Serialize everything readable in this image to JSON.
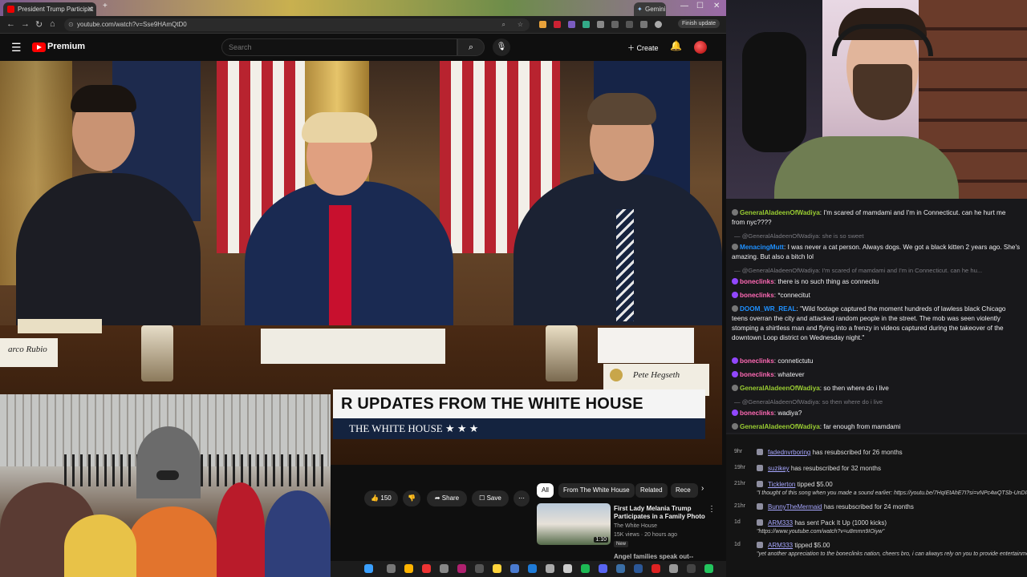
{
  "browser": {
    "tab_title": "President Trump Participat",
    "tab2_title": "Gemini",
    "url": "youtube.com/watch?v=Sse9HAmQtD0",
    "finish_update": "Finish update"
  },
  "youtube": {
    "brand": "Premium",
    "search_placeholder": "Search",
    "create_label": "Create"
  },
  "video": {
    "nameplate_left": "arco Rubio",
    "nameplate_right": "Pete Hegseth",
    "lower_third_title": "R UPDATES FROM THE WHITE HOUSE",
    "lower_third_sub": "THE WHITE HOUSE  ★ ★ ★"
  },
  "actions": {
    "likes": "150",
    "share": "Share",
    "save": "Save"
  },
  "chips": [
    "All",
    "From The White House",
    "Related",
    "Rece"
  ],
  "related": {
    "title": "First Lady Melania Trump Participates in a Family Photo",
    "channel": "The White House",
    "meta": "15K views · 20 hours ago",
    "badge": "New",
    "duration": "1:10",
    "next_title": "Angel families speak out--"
  },
  "chat": [
    {
      "type": "msg",
      "user": "GeneralAladeenOfWadiya",
      "color": "#9acd32",
      "text": " I'm scared of mamdami and I'm in Connecticut. can he hurt me from nyc????"
    },
    {
      "type": "reply",
      "text": "— @GeneralAladeenOfWadiya: she is so sweet"
    },
    {
      "type": "msg",
      "user": "MenacingMutt",
      "color": "#1e90ff",
      "text": " I was never a cat person. Always dogs. We got a black kitten 2 years ago. She's amazing. But also a bitch lol"
    },
    {
      "type": "reply",
      "text": "— @GeneralAladeenOfWadiya: I'm scared of mamdami and I'm in Connecticut. can he hu..."
    },
    {
      "type": "msg",
      "user": "boneclinks",
      "color": "#ff69b4",
      "text": " there is no such thing as connecitu"
    },
    {
      "type": "msg",
      "user": "boneclinks",
      "color": "#ff69b4",
      "text": " *connecitut"
    },
    {
      "type": "msg",
      "user": "DOOM_WR_REAL",
      "color": "#1e90ff",
      "text": " \"Wild footage captured the moment hundreds of lawless black Chicago teens overran the city and attacked random people in the street. The mob was seen violently stomping a shirtless man and flying into a frenzy in videos captured during the takeover of the downtown Loop district on Wednesday night.\""
    },
    {
      "type": "msg",
      "user": "boneclinks",
      "color": "#ff69b4",
      "text": " connetictutu"
    },
    {
      "type": "msg",
      "user": "boneclinks",
      "color": "#ff69b4",
      "text": " whatever"
    },
    {
      "type": "msg",
      "user": "GeneralAladeenOfWadiya",
      "color": "#9acd32",
      "text": " so then where do i live"
    },
    {
      "type": "reply",
      "text": "— @GeneralAladeenOfWadiya: so then where do i live"
    },
    {
      "type": "msg",
      "user": "boneclinks",
      "color": "#ff69b4",
      "text": " wadiya?"
    },
    {
      "type": "msg",
      "user": "GeneralAladeenOfWadiya",
      "color": "#9acd32",
      "text": " far enough from mamdami"
    }
  ],
  "events": [
    {
      "time": "9hr",
      "name": "fadednvrboring",
      "text": " has resubscribed for 26 months"
    },
    {
      "time": "19hr",
      "name": "suzikey",
      "text": " has resubscribed for 32 months"
    },
    {
      "time": "21hr",
      "name": "Ticklerton",
      "text": " tipped $5.00",
      "sub": "\"I thought of this song when you made a sound earlier: https://youtu.be/7HqIEtAhE7I?si=vNPc4wQTSb-UnDI4\""
    },
    {
      "time": "21hr",
      "name": "BunnyTheMermaid",
      "text": " has resubscribed for 24 months"
    },
    {
      "time": "1d",
      "name": "ARM333",
      "text": " has sent Pack It Up (1000 kicks)",
      "sub": "\"https://www.youtube.com/watch?v=u8mmn9IOiyw\""
    },
    {
      "time": "1d",
      "name": "ARM333",
      "text": " tipped $5.00",
      "sub": "\"yet another appreciation to the boneclinks nation, cheers bro, i can always rely on you to provide entertainment when i need it, thanks bro\""
    }
  ],
  "colors": {
    "accent": "#ff0000",
    "chat_bg": "#18181b",
    "yt_bg": "#0f0f0f"
  }
}
